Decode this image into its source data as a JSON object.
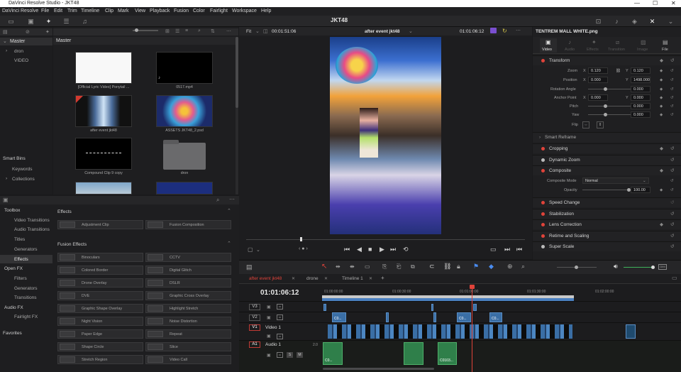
{
  "window": {
    "title": "DaVinci Resolve Studio - JKT48"
  },
  "menu": [
    "DaVinci Resolve",
    "File",
    "Edit",
    "Trim",
    "Timeline",
    "Clip",
    "Mark",
    "View",
    "Playback",
    "Fusion",
    "Color",
    "Fairlight",
    "Workspace",
    "Help"
  ],
  "project_title": "JKT48",
  "viewer": {
    "fit": "Fit",
    "source_tc": "00:01:51:06",
    "clip_name": "after event jkt48",
    "timeline_tc": "01:01:06:12"
  },
  "inspector": {
    "clip_name": "TENTREM MALL WHITE.png",
    "tabs": [
      "Video",
      "Audio",
      "Effects",
      "Transition",
      "Image",
      "File"
    ],
    "transform": {
      "title": "Transform",
      "zoom_label": "Zoom",
      "zoom_x": "0.120",
      "zoom_y": "0.120",
      "position_label": "Position",
      "position_x": "0.000",
      "position_y": "1498.000",
      "rotation_label": "Rotation Angle",
      "rotation": "0.000",
      "anchor_label": "Anchor Point",
      "anchor_x": "0.000",
      "anchor_y": "0.000",
      "pitch_label": "Pitch",
      "pitch": "0.000",
      "yaw_label": "Yaw",
      "yaw": "0.000",
      "flip_label": "Flip",
      "x": "X",
      "y": "Y"
    },
    "smart_reframe": "Smart Reframe",
    "cropping": "Cropping",
    "dynamic_zoom": "Dynamic Zoom",
    "composite": {
      "title": "Composite",
      "mode_label": "Composite Mode",
      "mode": "Normal",
      "opacity_label": "Opacity",
      "opacity": "100.00"
    },
    "sections": [
      "Speed Change",
      "Stabilization",
      "Lens Correction",
      "Retime and Scaling",
      "Super Scale"
    ]
  },
  "media_pool": {
    "bins_header": "Master",
    "bins": [
      "Master",
      "dron",
      "VIDEO"
    ],
    "smart_bins": "Smart Bins",
    "smart_items": [
      "Keywords",
      "Collections"
    ],
    "clips": [
      {
        "name": "[Official Lyric Video] Ponytail ..."
      },
      {
        "name": "0517.mp4"
      },
      {
        "name": "after event jkt48"
      },
      {
        "name": "ASSETS JKT48_2.psd"
      },
      {
        "name": "Compound Clip 9 copy"
      },
      {
        "name": "dron"
      }
    ]
  },
  "effects_panel": {
    "tree": [
      "Toolbox",
      "Video Transitions",
      "Audio Transitions",
      "Titles",
      "Generators",
      "Effects",
      "Open FX",
      "Filters",
      "Generators",
      "Transitions",
      "Audio FX",
      "Fairlight FX",
      "Favorites"
    ],
    "effects_header": "Effects",
    "effects": [
      "Adjustment Clip",
      "Fusion Composition"
    ],
    "fusion_header": "Fusion Effects",
    "fusion_effects": [
      "Binoculars",
      "CCTV",
      "Colored Border",
      "Digital Glitch",
      "Drone Overlay",
      "DSLR",
      "DVE",
      "Graphic Cross Overlay",
      "Graphic Shape Overlay",
      "Highlight Stretch",
      "Night Vision",
      "Noise Distortion",
      "Paper Edge",
      "Repeat",
      "Shape Circle",
      "Slice",
      "Stretch Region",
      "Video Call"
    ]
  },
  "timeline": {
    "tabs": [
      "after event jkt48",
      "drone",
      "Timeline 1"
    ],
    "timecode": "01:01:06:12",
    "ruler": [
      "01:00:00:00",
      "01:00:30:00",
      "01:01:00:00",
      "01:01:30:00",
      "01:02:00:00"
    ],
    "tracks": [
      {
        "id": "V3",
        "name": ""
      },
      {
        "id": "V2",
        "name": ""
      },
      {
        "id": "V1",
        "name": "Video 1"
      },
      {
        "id": "A1",
        "name": "Audio 1",
        "level": "2.0"
      }
    ],
    "clip_labels": [
      "C0...",
      "C0...",
      "C0...",
      "C0103..."
    ]
  },
  "colors": {
    "accent_red": "#e0433a",
    "timeline_blue": "#3a6ea5",
    "audio_green": "#2f7f4a"
  }
}
